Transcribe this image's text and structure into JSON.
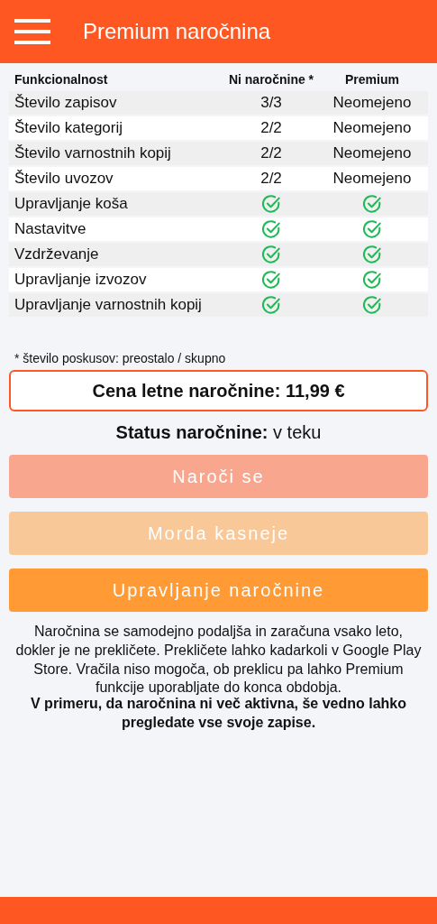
{
  "app_bar": {
    "title": "Premium naročnina"
  },
  "table": {
    "columns": [
      "Funkcionalnost",
      "Ni naročnine *",
      "Premium"
    ],
    "rows": [
      {
        "feature": "Število zapisov",
        "free": {
          "kind": "text",
          "text": "3/3"
        },
        "premium": {
          "kind": "text",
          "text": "Neomejeno"
        }
      },
      {
        "feature": "Število kategorij",
        "free": {
          "kind": "text",
          "text": "2/2"
        },
        "premium": {
          "kind": "text",
          "text": "Neomejeno"
        }
      },
      {
        "feature": "Število varnostnih kopij",
        "free": {
          "kind": "text",
          "text": "2/2"
        },
        "premium": {
          "kind": "text",
          "text": "Neomejeno"
        }
      },
      {
        "feature": "Število uvozov",
        "free": {
          "kind": "text",
          "text": "2/2"
        },
        "premium": {
          "kind": "text",
          "text": "Neomejeno"
        }
      },
      {
        "feature": "Upravljanje koša",
        "free": {
          "kind": "check"
        },
        "premium": {
          "kind": "check"
        }
      },
      {
        "feature": "Nastavitve",
        "free": {
          "kind": "check"
        },
        "premium": {
          "kind": "check"
        }
      },
      {
        "feature": "Vzdrževanje",
        "free": {
          "kind": "check"
        },
        "premium": {
          "kind": "check"
        }
      },
      {
        "feature": "Upravljanje izvozov",
        "free": {
          "kind": "check"
        },
        "premium": {
          "kind": "check"
        }
      },
      {
        "feature": "Upravljanje varnostnih kopij",
        "free": {
          "kind": "check"
        },
        "premium": {
          "kind": "check"
        }
      }
    ]
  },
  "footnote": "* število poskusov: preostalo / skupno",
  "price": "Cena letne naročnine: 11,99 €",
  "status": "**Status naročnine:** v teku",
  "buttons": [
    {
      "label": "Naroči se",
      "kind": "subscribe",
      "disabled": true
    },
    {
      "label": "Morda kasneje",
      "kind": "later",
      "disabled": true
    },
    {
      "label": "Upravljanje naročnine",
      "kind": "manage",
      "disabled": false
    }
  ],
  "notice": "Naročnina se samodejno podaljša in zaračuna vsako leto, dokler je ne prekličete. Prekličete lahko kadarkoli v Google Play Store. Vračila niso mogoča, ob preklicu pa lahko Premium funkcije uporabljate do konca obdobja.",
  "notice_bold": "V primeru, da naročnina ni več aktivna, še vedno lahko pregledate vse svoje zapise."
}
